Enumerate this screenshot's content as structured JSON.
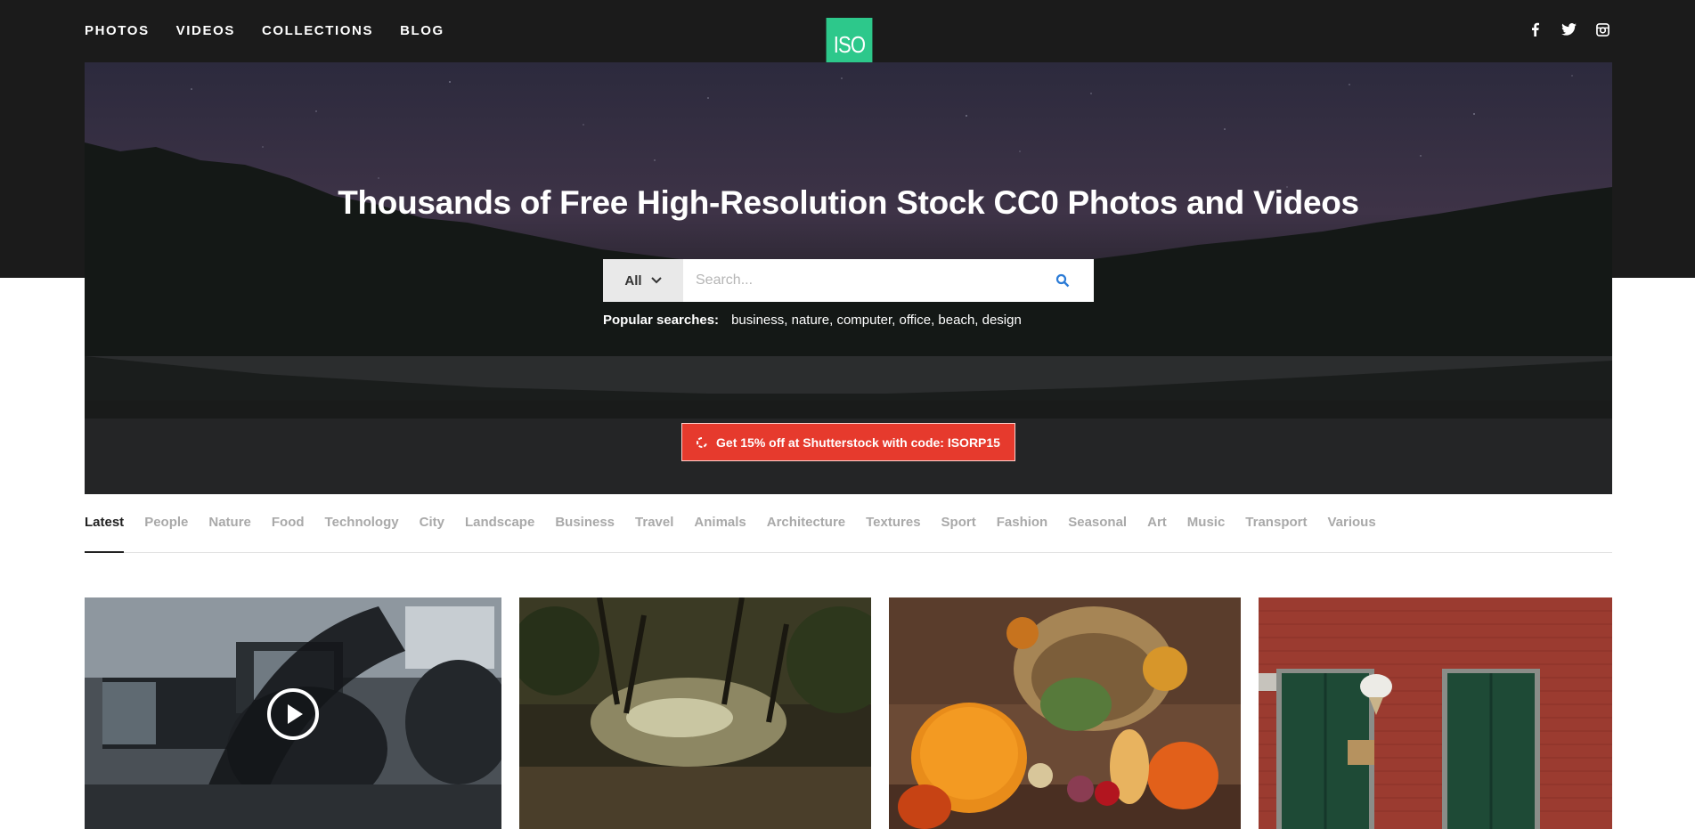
{
  "nav": {
    "items": [
      "PHOTOS",
      "VIDEOS",
      "COLLECTIONS",
      "BLOG"
    ],
    "logo_text": "ISO",
    "social": [
      "facebook-icon",
      "twitter-icon",
      "instagram-icon"
    ]
  },
  "hero": {
    "title": "Thousands of Free High-Resolution Stock CC0 Photos and Videos",
    "search": {
      "category": "All",
      "placeholder": "Search..."
    },
    "popular_label": "Popular searches:",
    "popular_terms": "business, nature, computer, office, beach, design",
    "promo_text": "Get 15% off at Shutterstock with code: ISORP15"
  },
  "categories": [
    "Latest",
    "People",
    "Nature",
    "Food",
    "Technology",
    "City",
    "Landscape",
    "Business",
    "Travel",
    "Animals",
    "Architecture",
    "Textures",
    "Sport",
    "Fashion",
    "Seasonal",
    "Art",
    "Music",
    "Transport",
    "Various"
  ],
  "active_category": "Latest",
  "colors": {
    "brand": "#2dc88b",
    "promo": "#e63a2d",
    "header_bg": "#1b1b1b"
  },
  "grid": [
    {
      "kind": "video",
      "subject": "office-workers"
    },
    {
      "kind": "photo",
      "subject": "forest-path"
    },
    {
      "kind": "photo",
      "subject": "harvest-basket"
    },
    {
      "kind": "photo",
      "subject": "brick-wall-green-doors"
    }
  ]
}
